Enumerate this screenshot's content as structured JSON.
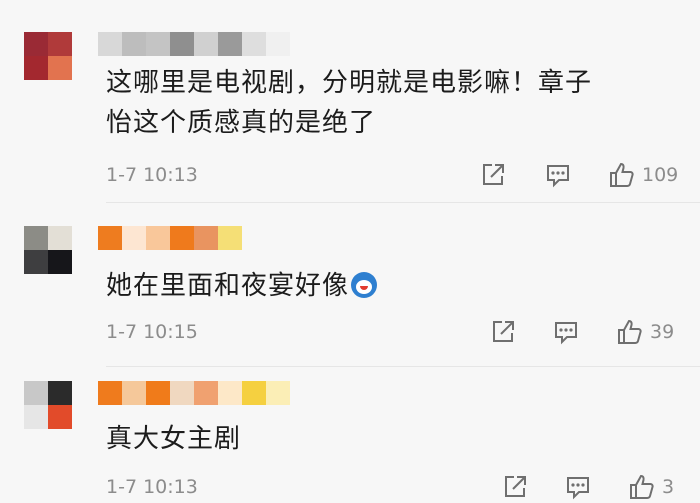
{
  "comments": [
    {
      "avatar_colors": [
        "#9a2a35",
        "#b03a3a",
        "#a3282f",
        "#e2734f"
      ],
      "name_colors": [
        "#d8d8d8",
        "#bdbdbd",
        "#c4c4c4",
        "#8f8f8f",
        "#d0d0d0",
        "#9a9a9a",
        "#dedede",
        "#f0f0f0"
      ],
      "text_line1": "这哪里是电视剧，分明就是电影嘛！章子",
      "text_line2": "怡这个质感真的是绝了",
      "time": "1-7 10:13",
      "likes": "109"
    },
    {
      "avatar_colors": [
        "#8c8c86",
        "#e3dfd6",
        "#3e3e40",
        "#16161a"
      ],
      "name_colors": [
        "#ee7c1f",
        "#fde6d2",
        "#f9c79a",
        "#ef7a1c",
        "#e99460",
        "#f5df76"
      ],
      "text": "她在里面和夜宴好像",
      "emoji_name": "doraemon-emoji",
      "time": "1-7 10:15",
      "likes": "39"
    },
    {
      "avatar_colors": [
        "#c8c8c8",
        "#2b2b2b",
        "#e6e6e6",
        "#e24b2a"
      ],
      "name_colors": [
        "#ef7b1d",
        "#f5c89a",
        "#f07b1a",
        "#f0d8c0",
        "#f0a170",
        "#fde8c8",
        "#f5d040",
        "#fbeeb6"
      ],
      "text": "真大女主剧",
      "time": "1-7 10:13",
      "likes": "3"
    }
  ],
  "icons": {
    "share": "share-icon",
    "reply": "comment-icon",
    "like": "thumbs-up-icon"
  }
}
